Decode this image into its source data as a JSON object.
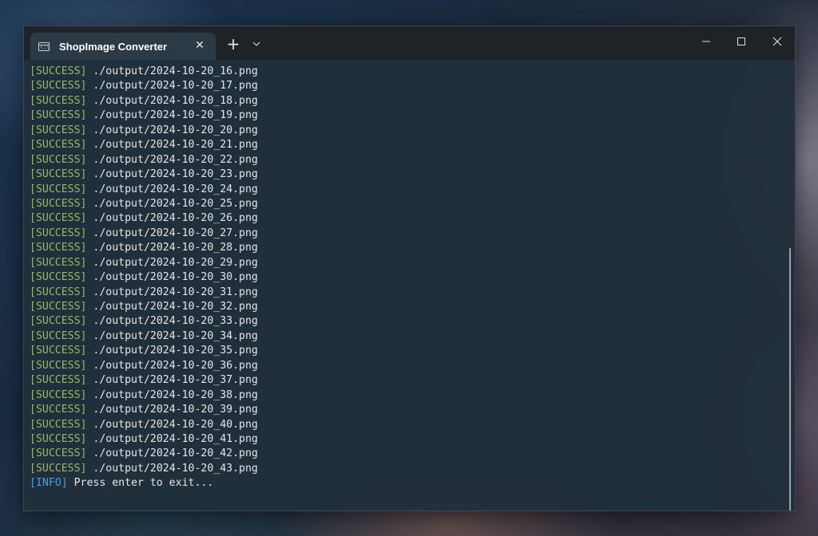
{
  "window": {
    "title": "ShopImage Converter",
    "close_tab_label": "✕",
    "new_tab_label": "+",
    "icon_text": "C:\\"
  },
  "colors": {
    "success_tag": "#98b86a",
    "info_tag": "#4aa0e0",
    "text": "#e6e6e6"
  },
  "log": {
    "success_tag": "[SUCCESS]",
    "info_tag": "[INFO]",
    "lines": [
      "./output/2024-10-20_16.png",
      "./output/2024-10-20_17.png",
      "./output/2024-10-20_18.png",
      "./output/2024-10-20_19.png",
      "./output/2024-10-20_20.png",
      "./output/2024-10-20_21.png",
      "./output/2024-10-20_22.png",
      "./output/2024-10-20_23.png",
      "./output/2024-10-20_24.png",
      "./output/2024-10-20_25.png",
      "./output/2024-10-20_26.png",
      "./output/2024-10-20_27.png",
      "./output/2024-10-20_28.png",
      "./output/2024-10-20_29.png",
      "./output/2024-10-20_30.png",
      "./output/2024-10-20_31.png",
      "./output/2024-10-20_32.png",
      "./output/2024-10-20_33.png",
      "./output/2024-10-20_34.png",
      "./output/2024-10-20_35.png",
      "./output/2024-10-20_36.png",
      "./output/2024-10-20_37.png",
      "./output/2024-10-20_38.png",
      "./output/2024-10-20_39.png",
      "./output/2024-10-20_40.png",
      "./output/2024-10-20_41.png",
      "./output/2024-10-20_42.png",
      "./output/2024-10-20_43.png"
    ],
    "info_message": "Press enter to exit..."
  }
}
